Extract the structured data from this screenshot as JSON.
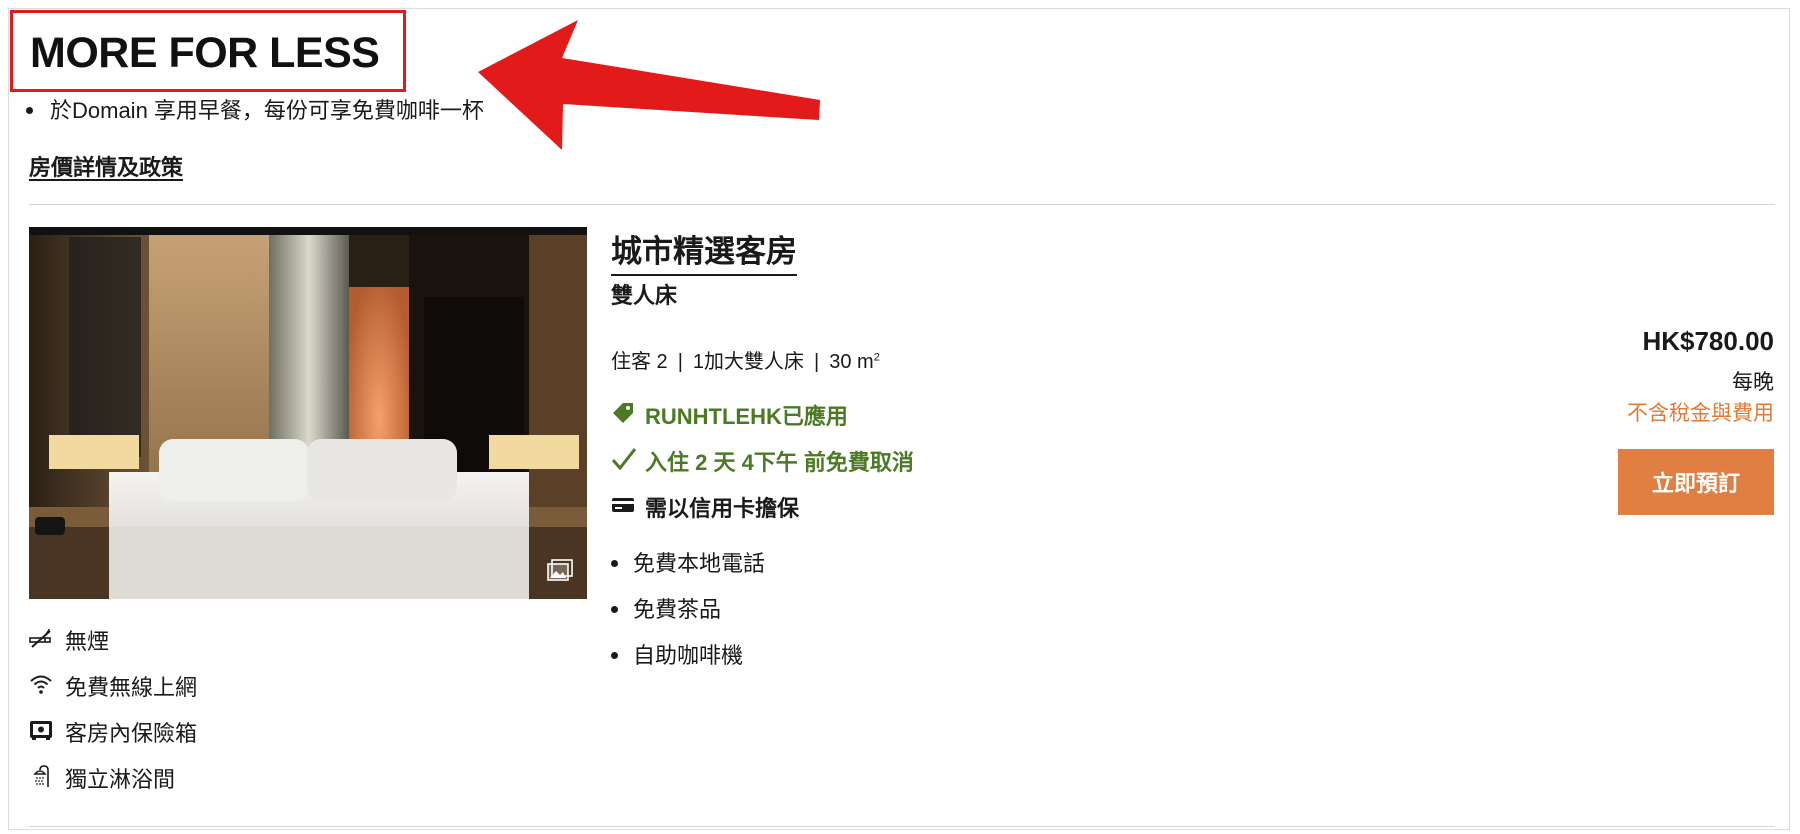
{
  "promo": {
    "title": "MORE FOR LESS",
    "bullet": "於Domain 享用早餐，每份可享免費咖啡一杯",
    "policy_link": "房價詳情及政策"
  },
  "room": {
    "name": "城市精選客房",
    "bed_type": "雙人床",
    "specs": {
      "guests": "住客 2",
      "bed": "1加大雙人床",
      "size": "30 m",
      "size_sup": "2"
    },
    "offers": [
      {
        "icon": "tag-icon",
        "text": "RUNHTLEHK已應用"
      },
      {
        "icon": "checkmark-icon",
        "text": "入住 2 天 4下午 前免費取消"
      },
      {
        "icon": "credit-card-icon",
        "text": "需以信用卡擔保"
      }
    ],
    "features": [
      "免費本地電話",
      "免費茶品",
      "自助咖啡機"
    ],
    "amenities": [
      {
        "icon": "no-smoking-icon",
        "label": "無煙"
      },
      {
        "icon": "wifi-icon",
        "label": "免費無線上網"
      },
      {
        "icon": "safe-icon",
        "label": "客房內保險箱"
      },
      {
        "icon": "shower-icon",
        "label": "獨立淋浴間"
      }
    ]
  },
  "pricing": {
    "price": "HK$780.00",
    "per_night": "每晚",
    "tax_note": "不含稅金與費用",
    "book_label": "立即預訂"
  },
  "colors": {
    "accent_orange": "#e07f41",
    "offer_green": "#4b7a24",
    "annotation_red": "#e21a1a"
  }
}
